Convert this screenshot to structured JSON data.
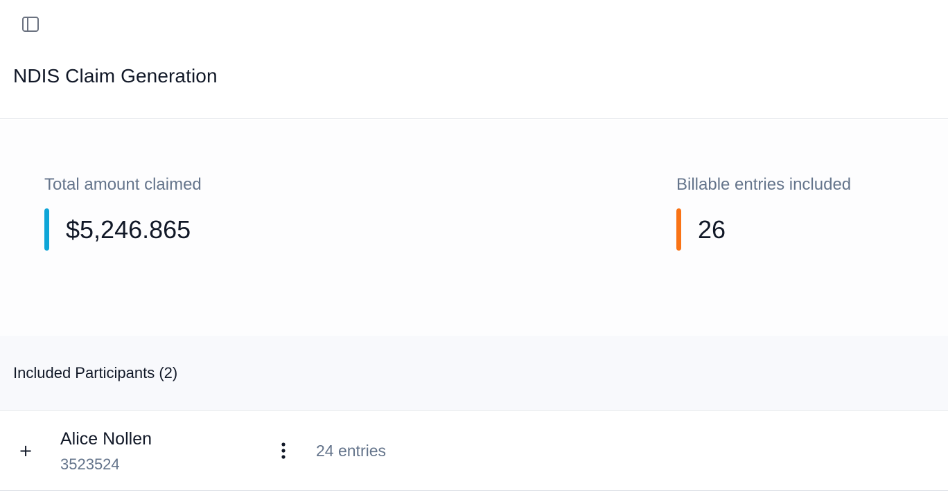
{
  "header": {
    "sidebar_toggle_icon": "sidebar-panel-icon",
    "title": "NDIS Claim Generation"
  },
  "stats": {
    "total_amount": {
      "label": "Total amount claimed",
      "value": "$5,246.865",
      "accent_color": "#0ea5d7"
    },
    "billable_entries": {
      "label": "Billable entries included",
      "value": "26",
      "accent_color": "#f97316"
    }
  },
  "participants": {
    "title": "Included Participants (2)",
    "rows": [
      {
        "expand_label": "+",
        "name": "Alice Nollen",
        "id": "3523524",
        "menu_icon": "vertical-ellipsis-icon",
        "entries": "24 entries"
      }
    ]
  },
  "colors": {
    "muted_text": "#64748b",
    "primary_text": "#111827",
    "border": "#e2e5ea",
    "section_bg": "#f8f9fc"
  }
}
